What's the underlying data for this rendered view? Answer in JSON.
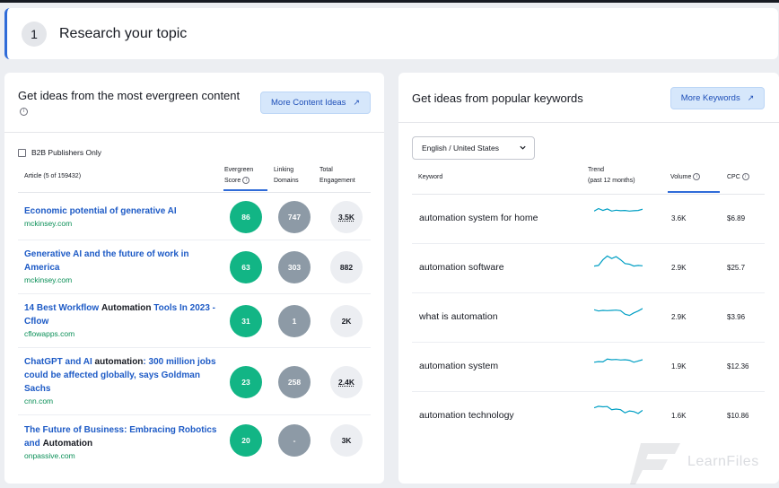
{
  "step": {
    "number": "1",
    "title": "Research your topic"
  },
  "content_panel": {
    "title": "Get ideas from the most evergreen content",
    "button_label": "More Content Ideas",
    "filter_label": "B2B Publishers Only",
    "columns": {
      "article": "Article (5 of 159432)",
      "evergreen_line1": "Evergreen",
      "evergreen_line2": "Score",
      "linking_line1": "Linking",
      "linking_line2": "Domains",
      "engagement_line1": "Total",
      "engagement_line2": "Engagement"
    },
    "articles": [
      {
        "title_parts": [
          [
            "Economic potential of generative AI",
            false
          ]
        ],
        "domain": "mckinsey.com",
        "evergreen": "86",
        "linking": "747",
        "engagement": "3.5K",
        "engagement_dotted": true
      },
      {
        "title_parts": [
          [
            "Generative AI and the future of work in America",
            false
          ]
        ],
        "domain": "mckinsey.com",
        "evergreen": "63",
        "linking": "303",
        "engagement": "882",
        "engagement_dotted": false
      },
      {
        "title_parts": [
          [
            "14 Best Workflow ",
            false
          ],
          [
            "Automation",
            true
          ],
          [
            " Tools In 2023 - Cflow",
            false
          ]
        ],
        "domain": "cflowapps.com",
        "evergreen": "31",
        "linking": "1",
        "engagement": "2K",
        "engagement_dotted": false
      },
      {
        "title_parts": [
          [
            "ChatGPT and AI ",
            false
          ],
          [
            "automation",
            true
          ],
          [
            ": 300 million jobs could be affected globally, says Goldman Sachs",
            false
          ]
        ],
        "domain": "cnn.com",
        "evergreen": "23",
        "linking": "258",
        "engagement": "2.4K",
        "engagement_dotted": true
      },
      {
        "title_parts": [
          [
            "The Future of Business: Embracing Robotics and ",
            false
          ],
          [
            "Automation",
            true
          ]
        ],
        "domain": "onpassive.com",
        "evergreen": "20",
        "linking": "-",
        "engagement": "3K",
        "engagement_dotted": false
      }
    ]
  },
  "keyword_panel": {
    "title": "Get ideas from popular keywords",
    "button_label": "More Keywords",
    "database_select": "English / United States",
    "columns": {
      "keyword": "Keyword",
      "trend_line1": "Trend",
      "trend_line2": "(past 12 months)",
      "volume": "Volume",
      "cpc": "CPC"
    },
    "keywords": [
      {
        "keyword": "automation system for home",
        "volume": "3.6K",
        "cpc": "$6.89",
        "trend": [
          0.55,
          0.75,
          0.6,
          0.72,
          0.55,
          0.62,
          0.58,
          0.6,
          0.55,
          0.58,
          0.6,
          0.7
        ]
      },
      {
        "keyword": "automation software",
        "volume": "2.9K",
        "cpc": "$25.7",
        "trend": [
          0.1,
          0.15,
          0.6,
          0.9,
          0.7,
          0.85,
          0.6,
          0.3,
          0.25,
          0.1,
          0.15,
          0.12
        ]
      },
      {
        "keyword": "what is automation",
        "volume": "2.9K",
        "cpc": "$3.96",
        "trend": [
          0.55,
          0.45,
          0.5,
          0.48,
          0.5,
          0.52,
          0.48,
          0.2,
          0.1,
          0.3,
          0.45,
          0.65
        ]
      },
      {
        "keyword": "automation system",
        "volume": "1.9K",
        "cpc": "$12.36",
        "trend": [
          0.3,
          0.35,
          0.33,
          0.55,
          0.5,
          0.52,
          0.48,
          0.5,
          0.46,
          0.3,
          0.4,
          0.5
        ]
      },
      {
        "keyword": "automation technology",
        "volume": "1.6K",
        "cpc": "$10.86",
        "trend": [
          0.6,
          0.72,
          0.68,
          0.7,
          0.45,
          0.5,
          0.45,
          0.2,
          0.35,
          0.3,
          0.15,
          0.4
        ]
      }
    ]
  },
  "watermark": {
    "text": "LearnFiles"
  },
  "colors": {
    "accent": "#2f6bd8",
    "green": "#12b585",
    "gray_metric": "#8d9aa6",
    "link": "#1e5bc6",
    "domain": "#0a8f57",
    "spark": "#009fc4"
  }
}
